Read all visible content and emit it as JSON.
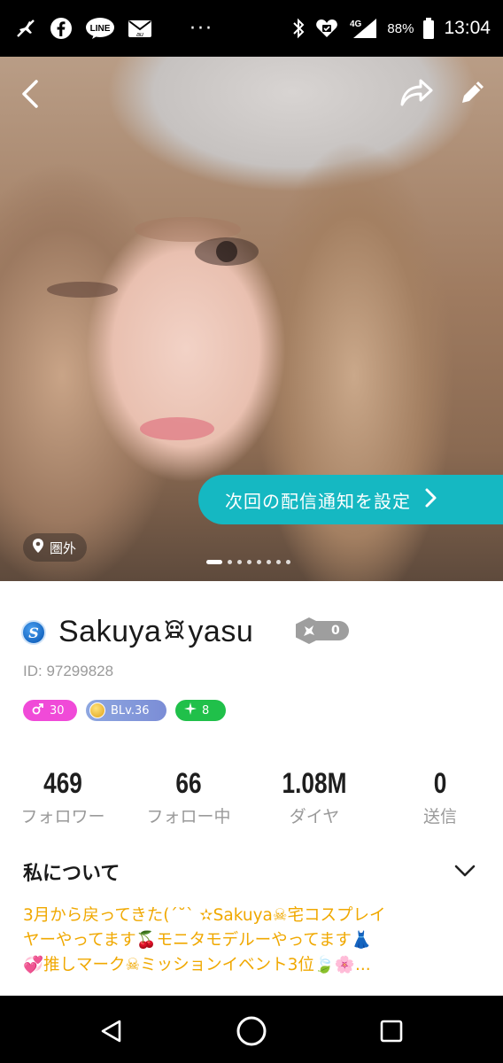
{
  "status_bar": {
    "icons_left": [
      "airplane-off-icon",
      "facebook-icon",
      "line-icon",
      "au-mail-icon"
    ],
    "more": "···",
    "icons_right": [
      "bluetooth-icon",
      "heart-shield-icon",
      "4g-signal-icon"
    ],
    "network": "4G",
    "battery": "88%",
    "time": "13:04"
  },
  "hero": {
    "notify_button": "次回の配信通知を設定",
    "location": "圏外",
    "image_count": 8,
    "active_image": 1
  },
  "profile": {
    "name_prefix": "Sakuya",
    "name_suffix": "yasu",
    "rank_value": "0",
    "user_id": "ID: 97299828",
    "badges": {
      "gender_level": "30",
      "broadcaster_level": "BLv.36",
      "green_level": "8"
    }
  },
  "stats": [
    {
      "value": "469",
      "label": "フォロワー"
    },
    {
      "value": "66",
      "label": "フォロー中"
    },
    {
      "value": "1.08M",
      "label": "ダイヤ"
    },
    {
      "value": "0",
      "label": "送信"
    }
  ],
  "about": {
    "title": "私について",
    "line1": "3月から戻ってきた(´˘` ✫Sakuya☠宅コスプレイ",
    "line2": "ヤーやってます🍒モニタモデルーやってます👗",
    "line3": "💞推しマーク☠ミッションイベント3位🍃🌸..."
  },
  "colors": {
    "accent_teal": "#15b8c2",
    "about_text": "#f0a800",
    "badge_pink": "#f04ad8",
    "badge_green": "#20c04a",
    "badge_blue": "#8ea7e0"
  }
}
